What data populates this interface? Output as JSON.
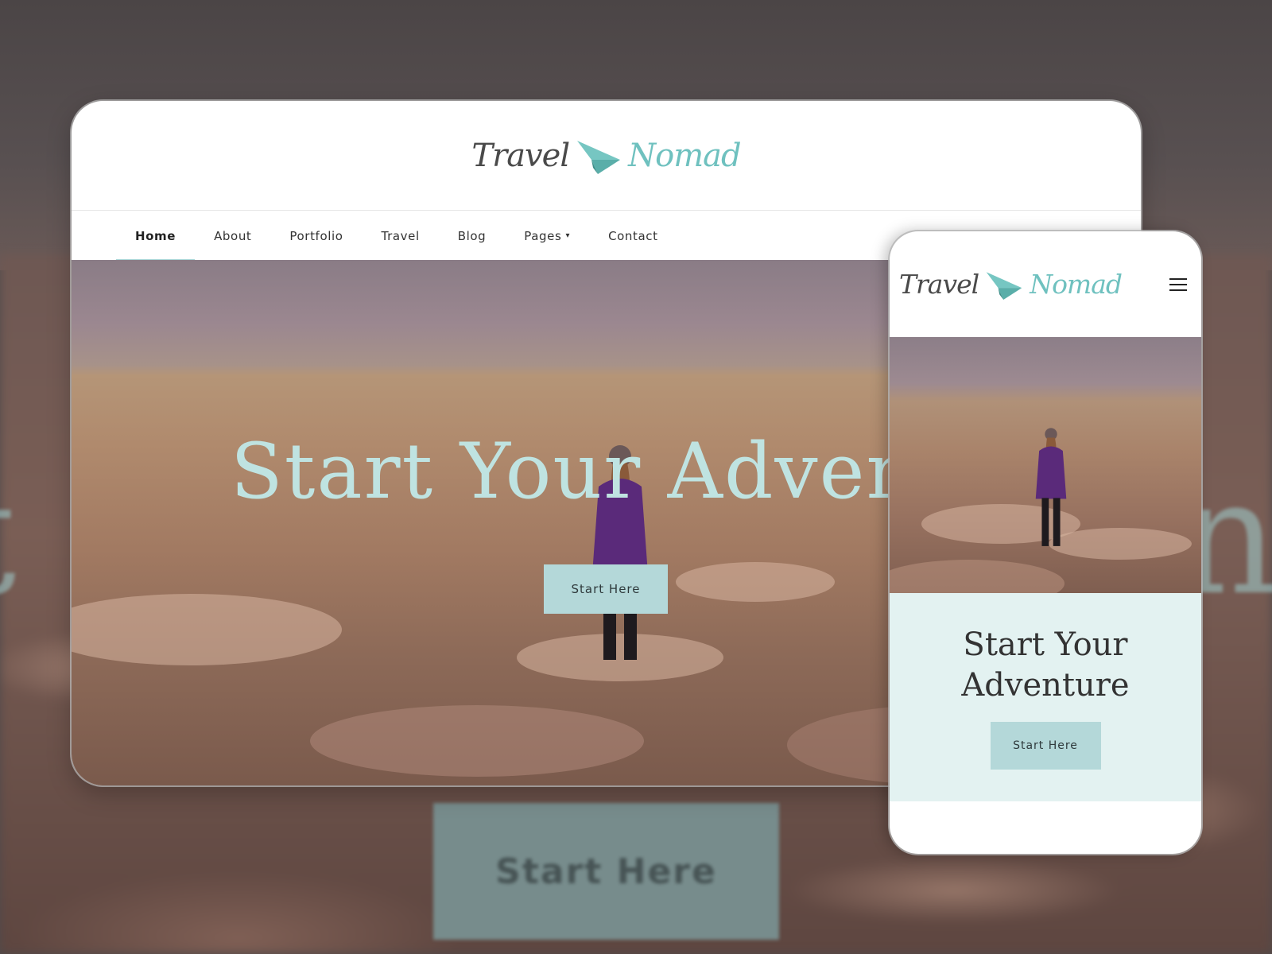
{
  "brand": {
    "word1": "Travel",
    "word2": "Nomad",
    "accent_color": "#6fc1bf",
    "text_color": "#4a4a4a"
  },
  "desktop": {
    "nav": {
      "items": [
        {
          "label": "Home",
          "active": true
        },
        {
          "label": "About"
        },
        {
          "label": "Portfolio"
        },
        {
          "label": "Travel"
        },
        {
          "label": "Blog"
        },
        {
          "label": "Pages",
          "has_dropdown": true
        },
        {
          "label": "Contact"
        }
      ],
      "dropdown_caret": "▾"
    },
    "hero": {
      "title": "Start Your Adventure",
      "button_label": "Start Here"
    }
  },
  "mobile": {
    "menu_icon": "hamburger-icon",
    "cta": {
      "title_line1": "Start Your",
      "title_line2": "Adventure",
      "button_label": "Start Here"
    }
  },
  "backdrop": {
    "button_label": "Start Here",
    "left_letter": "t",
    "right_letter": "n"
  },
  "colors": {
    "button_bg": "#b4d8d9",
    "cta_bg": "#e3f2f1",
    "hero_title": "#bfe3e1",
    "nav_active_underline": "#a8d5d6"
  }
}
